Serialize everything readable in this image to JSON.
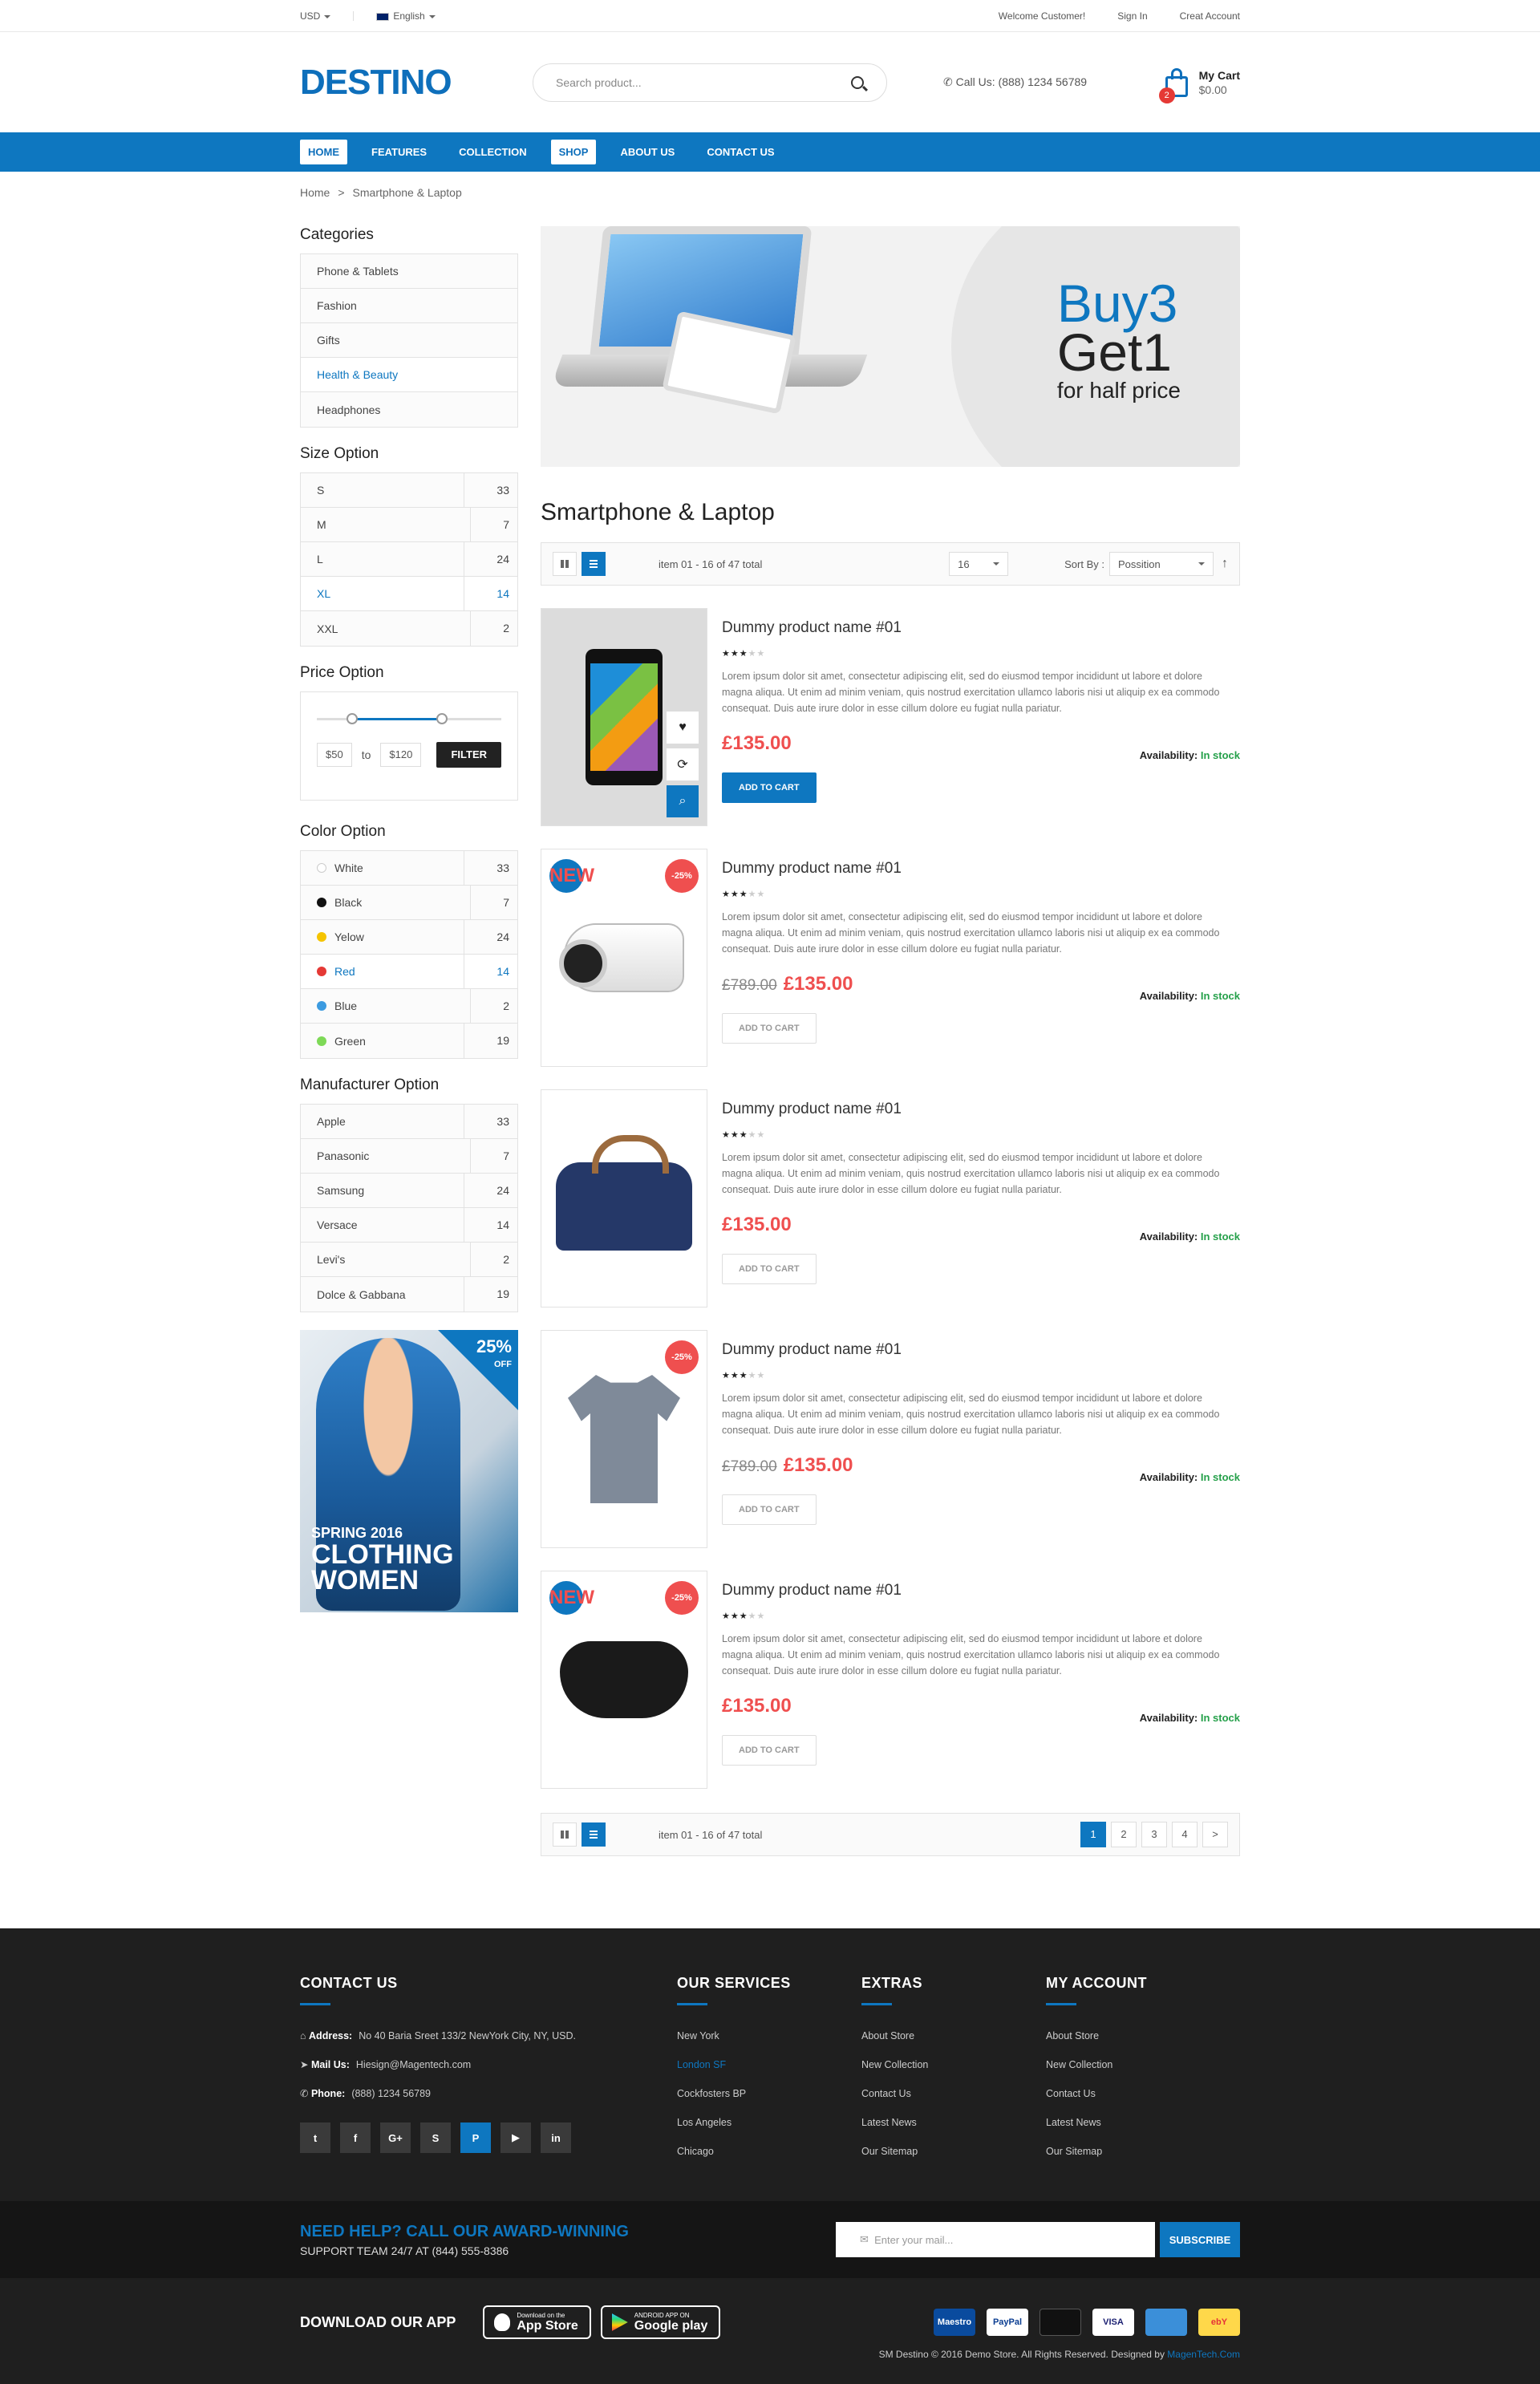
{
  "topbar": {
    "currency": "USD",
    "language": "English",
    "welcome": "Welcome Customer!",
    "signin": "Sign In",
    "create": "Creat Account"
  },
  "header": {
    "logo": "DESTINO",
    "search_placeholder": "Search product...",
    "call_label": "Call Us:",
    "call_number": "(888) 1234 56789",
    "cart_label": "My Cart",
    "cart_total": "$0.00",
    "cart_count": "2"
  },
  "nav": [
    "HOME",
    "FEATURES",
    "COLLECTION",
    "SHOP",
    "ABOUT US",
    "CONTACT US"
  ],
  "breadcrumb": {
    "home": "Home",
    "sep": ">",
    "current": "Smartphone & Laptop"
  },
  "sidebar": {
    "categories_title": "Categories",
    "categories": [
      "Phone & Tablets",
      "Fashion",
      "Gifts",
      "Health & Beauty",
      "Headphones"
    ],
    "size_title": "Size Option",
    "sizes": [
      {
        "label": "S",
        "count": "33"
      },
      {
        "label": "M",
        "count": "7"
      },
      {
        "label": "L",
        "count": "24"
      },
      {
        "label": "XL",
        "count": "14"
      },
      {
        "label": "XXL",
        "count": "2"
      }
    ],
    "price_title": "Price Option",
    "price_min": "$50",
    "price_to": "to",
    "price_max": "$120",
    "filter": "FILTER",
    "color_title": "Color Option",
    "colors": [
      {
        "label": "White",
        "count": "33",
        "hex": "#ffffff"
      },
      {
        "label": "Black",
        "count": "7",
        "hex": "#111111"
      },
      {
        "label": "Yelow",
        "count": "24",
        "hex": "#f5c400"
      },
      {
        "label": "Red",
        "count": "14",
        "hex": "#e53935"
      },
      {
        "label": "Blue",
        "count": "2",
        "hex": "#3c9be0"
      },
      {
        "label": "Green",
        "count": "19",
        "hex": "#7ed957"
      }
    ],
    "manu_title": "Manufacturer Option",
    "manufacturers": [
      {
        "label": "Apple",
        "count": "33"
      },
      {
        "label": "Panasonic",
        "count": "7"
      },
      {
        "label": "Samsung",
        "count": "24"
      },
      {
        "label": "Versace",
        "count": "14"
      },
      {
        "label": "Levi's",
        "count": "2"
      },
      {
        "label": "Dolce & Gabbana",
        "count": "19"
      }
    ],
    "promo": {
      "pct": "25%",
      "off": "OFF",
      "season": "SPRING 2016",
      "line1": "CLOTHING",
      "line2": "WOMEN"
    }
  },
  "banner": {
    "line1": "Buy3",
    "line2": "Get1",
    "line3": "for half price"
  },
  "category_title": "Smartphone & Laptop",
  "toolbar": {
    "total": "item 01 - 16 of 47 total",
    "limit": "16",
    "sort_label": "Sort By :",
    "sort_value": "Possition"
  },
  "products": [
    {
      "name": "Dummy product name #01",
      "old": "",
      "price": "£135.00",
      "badge_new": "",
      "badge_sale": "",
      "atc": "ADD TO CART"
    },
    {
      "name": "Dummy product name #01",
      "old": "£789.00",
      "price": "£135.00",
      "badge_new": "NEW",
      "badge_sale": "-25%",
      "atc": "ADD TO CART"
    },
    {
      "name": "Dummy product name #01",
      "old": "",
      "price": "£135.00",
      "badge_new": "",
      "badge_sale": "",
      "atc": "ADD TO CART"
    },
    {
      "name": "Dummy product name #01",
      "old": "£789.00",
      "price": "£135.00",
      "badge_new": "",
      "badge_sale": "-25%",
      "atc": "ADD TO CART"
    },
    {
      "name": "Dummy product name #01",
      "old": "",
      "price": "£135.00",
      "badge_new": "NEW",
      "badge_sale": "-25%",
      "atc": "ADD TO CART"
    }
  ],
  "product_desc": "Lorem ipsum dolor sit amet, consectetur adipiscing elit, sed do eiusmod tempor incididunt ut labore et dolore magna aliqua. Ut enim ad minim veniam, quis nostrud exercitation ullamco laboris nisi ut aliquip ex ea commodo consequat. Duis aute irure dolor in esse cillum dolore eu fugiat nulla pariatur.",
  "availability_label": "Availability:",
  "availability_value": "In stock",
  "pager": {
    "total": "item 01 - 16 of 47 total",
    "pages": [
      "1",
      "2",
      "3",
      "4",
      ">"
    ]
  },
  "footer": {
    "contact_title": "CONTACT US",
    "address_label": "Address:",
    "address": "No 40 Baria Sreet 133/2 NewYork City, NY, USD.",
    "mail_label": "Mail Us:",
    "mail": "Hiesign@Magentech.com",
    "phone_label": "Phone:",
    "phone": "(888) 1234 56789",
    "social": [
      "t",
      "f",
      "G+",
      "S",
      "P",
      "▶",
      "in"
    ],
    "services_title": "OUR SERVICES",
    "services": [
      "New York",
      "London SF",
      "Cockfosters BP",
      "Los Angeles",
      "Chicago"
    ],
    "extras_title": "EXTRAS",
    "extras": [
      "About Store",
      "New Collection",
      "Contact Us",
      "Latest News",
      "Our Sitemap"
    ],
    "account_title": "MY ACCOUNT",
    "account": [
      "About Store",
      "New Collection",
      "Contact Us",
      "Latest News",
      "Our Sitemap"
    ],
    "help_line1": "NEED HELP? CALL OUR AWARD-WINNING",
    "help_line2": "SUPPORT TEAM 24/7 AT (844) 555-8386",
    "mail_placeholder": "Enter your mail...",
    "subscribe": "SUBSCRIBE",
    "download": "DOWNLOAD OUR APP",
    "appstore_small": "Download on the",
    "appstore": "App Store",
    "gplay_small": "ANDROID APP ON",
    "gplay": "Google play",
    "payments": [
      "Maestro",
      "PayPal",
      "",
      "VISA",
      "",
      "ebY"
    ],
    "copyright": "SM Destino © 2016 Demo Store. All Rights Reserved. Designed by",
    "designer": "MagenTech.Com"
  }
}
